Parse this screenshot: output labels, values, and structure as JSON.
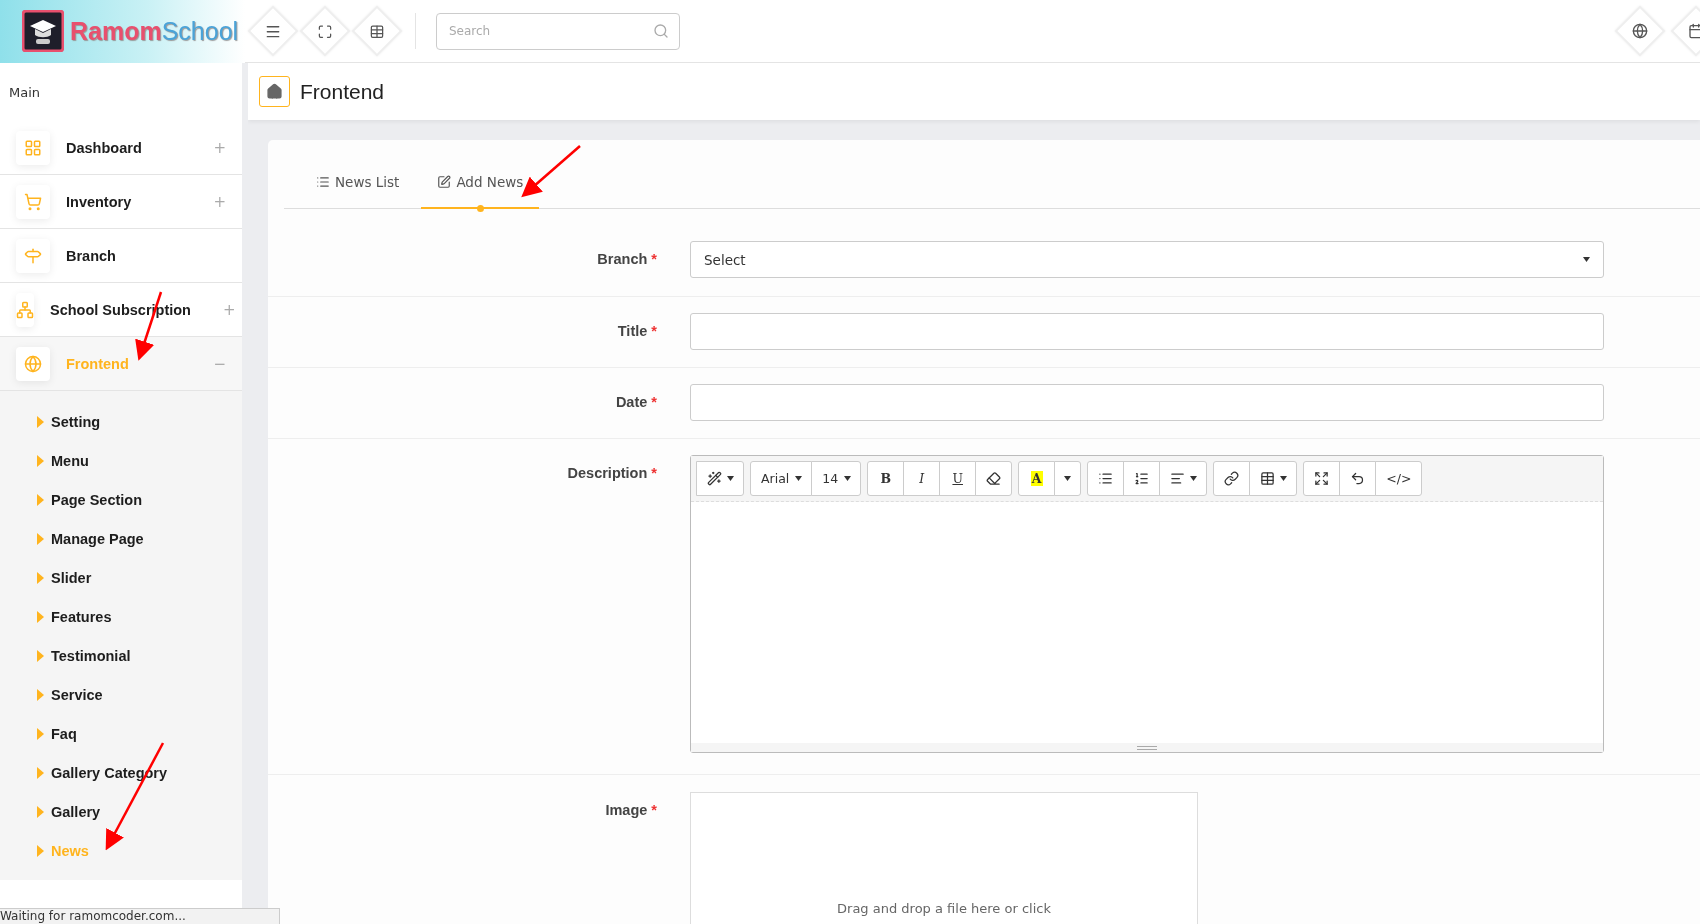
{
  "brand": {
    "primary": "Ramom",
    "secondary": "School"
  },
  "search": {
    "placeholder": "Search"
  },
  "page_title": "Frontend",
  "sidebar": {
    "heading": "Main",
    "items": [
      {
        "label": "Dashboard",
        "toggle": "+",
        "selected": false
      },
      {
        "label": "Inventory",
        "toggle": "+",
        "selected": false
      },
      {
        "label": "Branch",
        "selected": false
      },
      {
        "label": "School Subscription",
        "toggle": "+",
        "selected": false
      },
      {
        "label": "Frontend",
        "toggle": "−",
        "selected": true,
        "children": [
          {
            "label": "Setting",
            "selected": false
          },
          {
            "label": "Menu",
            "selected": false
          },
          {
            "label": "Page Section",
            "selected": false
          },
          {
            "label": "Manage Page",
            "selected": false
          },
          {
            "label": "Slider",
            "selected": false
          },
          {
            "label": "Features",
            "selected": false
          },
          {
            "label": "Testimonial",
            "selected": false
          },
          {
            "label": "Service",
            "selected": false
          },
          {
            "label": "Faq",
            "selected": false
          },
          {
            "label": "Gallery Category",
            "selected": false
          },
          {
            "label": "Gallery",
            "selected": false
          },
          {
            "label": "News",
            "selected": true
          }
        ]
      }
    ]
  },
  "tabs": [
    {
      "label": "News List",
      "selected": false
    },
    {
      "label": "Add News",
      "selected": true
    }
  ],
  "form": {
    "required_mark": "*",
    "fields": [
      {
        "label": "Branch",
        "required": true,
        "kind": "select",
        "value": "Select"
      },
      {
        "label": "Title",
        "required": true,
        "kind": "text"
      },
      {
        "label": "Date",
        "required": true,
        "kind": "text"
      },
      {
        "label": "Description",
        "required": true,
        "kind": "editor",
        "toolbar": [
          [
            {
              "kind": "magic"
            }
          ],
          [
            {
              "kind": "font",
              "text": "Arial"
            },
            {
              "kind": "size",
              "text": "14"
            }
          ],
          [
            {
              "kind": "bold",
              "text": "B"
            },
            {
              "kind": "italic",
              "text": "I"
            },
            {
              "kind": "underline",
              "text": "U"
            },
            {
              "kind": "eraser"
            }
          ],
          [
            {
              "kind": "highlight",
              "text": "A"
            },
            {
              "kind": "caret"
            }
          ],
          [
            {
              "kind": "bullets"
            },
            {
              "kind": "numbers"
            },
            {
              "kind": "align"
            }
          ],
          [
            {
              "kind": "link"
            },
            {
              "kind": "table"
            }
          ],
          [
            {
              "kind": "fullscreen"
            },
            {
              "kind": "undo"
            },
            {
              "kind": "code",
              "text": "</>"
            }
          ]
        ]
      },
      {
        "label": "Image",
        "required": true,
        "kind": "file",
        "hint": "Drag and drop a file here or click"
      }
    ]
  },
  "status_bar": "Waiting for ramomcoder.com..."
}
